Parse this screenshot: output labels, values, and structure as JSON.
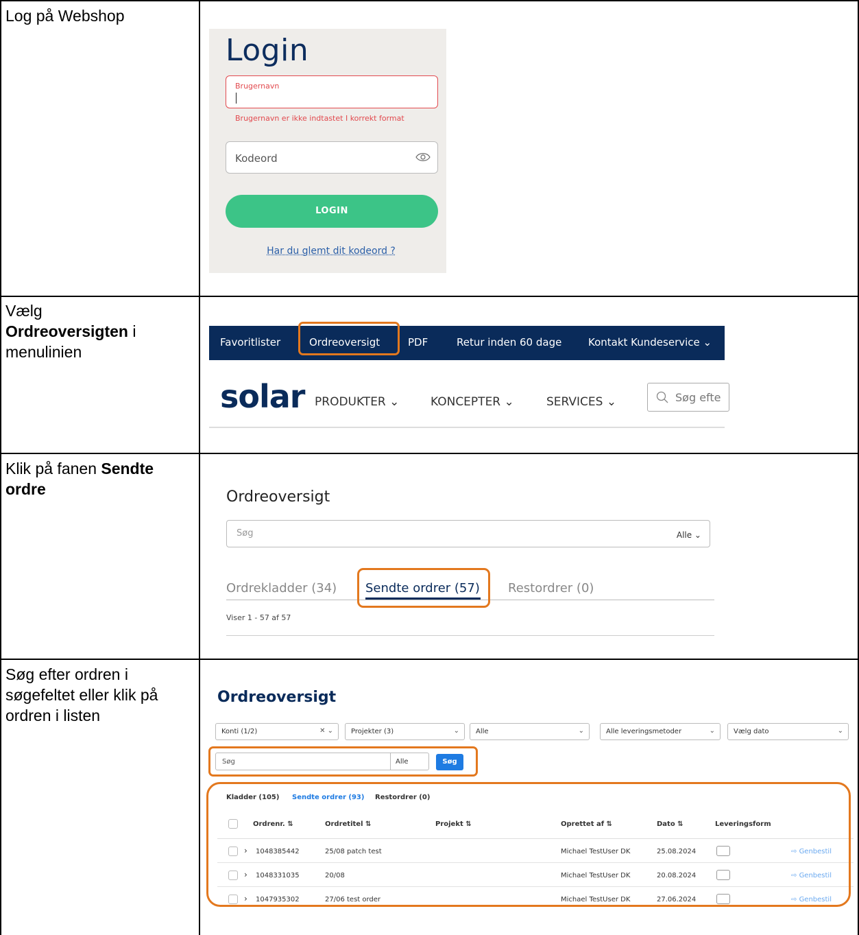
{
  "steps": [
    {
      "instruction_parts": [
        "Log på Webshop"
      ]
    },
    {
      "instruction_pre": "Vælg ",
      "instruction_bold": "Ordreoversigten",
      "instruction_post": " i menulinien"
    },
    {
      "instruction_pre": "Klik på fanen ",
      "instruction_bold": "Sendte ordre",
      "instruction_post": ""
    },
    {
      "instruction_parts": [
        "Søg efter ordren i søgefeltet eller klik på ordren i listen"
      ]
    }
  ],
  "login": {
    "title": "Login",
    "username_label": "Brugernavn",
    "username_error": "Brugernavn er ikke indtastet I korrekt format",
    "password_placeholder": "Kodeord",
    "login_button": "LOGIN",
    "forgot_link": "Har du glemt dit kodeord ?"
  },
  "topnav": {
    "items": [
      "Favoritlister",
      "Ordreoversigt",
      "PDF",
      "Retur inden 60 dage",
      "Kontakt Kundeservice ⌄"
    ],
    "logo": "solar",
    "menu": [
      "PRODUKTER ⌄",
      "KONCEPTER ⌄",
      "SERVICES ⌄"
    ],
    "search_placeholder": "Søg efte"
  },
  "tabs_view": {
    "title": "Ordreoversigt",
    "search_placeholder": "Søg",
    "scope": "Alle ⌄",
    "tabs": [
      "Ordrekladder (34)",
      "Sendte ordrer (57)",
      "Restordrer (0)"
    ],
    "count": "Viser 1 - 57 af 57"
  },
  "order_view": {
    "title": "Ordreoversigt",
    "filters": [
      "Konti (1/2)",
      "Projekter (3)",
      "Alle",
      "Alle leveringsmetoder",
      "Vælg dato"
    ],
    "search_placeholder": "Søg",
    "scope": "Alle",
    "search_button": "Søg",
    "tabs": [
      "Kladder (105)",
      "Sendte ordrer (93)",
      "Restordrer (0)"
    ],
    "columns": [
      "Ordrenr. ⇅",
      "Ordretitel ⇅",
      "Projekt ⇅",
      "Oprettet af ⇅",
      "Dato ⇅",
      "Leveringsform"
    ],
    "rows": [
      {
        "order_no": "1048385442",
        "title": "25/08 patch test",
        "project": "",
        "created_by": "Michael TestUser DK",
        "date": "25.08.2024",
        "action": "Genbestil"
      },
      {
        "order_no": "1048331035",
        "title": "20/08",
        "project": "",
        "created_by": "Michael TestUser DK",
        "date": "20.08.2024",
        "action": "Genbestil"
      },
      {
        "order_no": "1047935302",
        "title": "27/06 test order",
        "project": "",
        "created_by": "Michael TestUser DK",
        "date": "27.06.2024",
        "action": "Genbestil"
      }
    ]
  },
  "colors": {
    "navy": "#0a2b5a",
    "highlight": "#e3781e",
    "green": "#3cc487",
    "error": "#e2494e",
    "link": "#2b5fa8",
    "button_blue": "#1e7be2"
  }
}
